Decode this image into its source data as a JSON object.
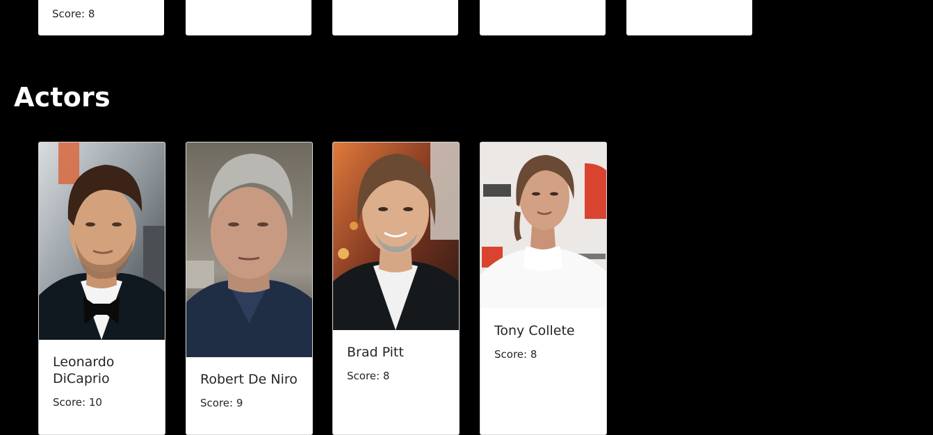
{
  "top_cards": [
    {
      "score_text": "Score: 8"
    },
    {
      "score_text": ""
    },
    {
      "score_text": ""
    },
    {
      "score_text": ""
    },
    {
      "score_text": ""
    }
  ],
  "actors_section": {
    "title": "Actors",
    "cards": [
      {
        "name": "Leonardo DiCaprio",
        "score_text": "Score: 10",
        "photo_alt": "Leonardo DiCaprio photo"
      },
      {
        "name": "Robert De Niro",
        "score_text": "Score: 9",
        "photo_alt": "Robert De Niro photo"
      },
      {
        "name": "Brad Pitt",
        "score_text": "Score: 8",
        "photo_alt": "Brad Pitt photo"
      },
      {
        "name": "Tony Collete",
        "score_text": "Score: 8",
        "photo_alt": "Tony Collete photo"
      }
    ]
  }
}
